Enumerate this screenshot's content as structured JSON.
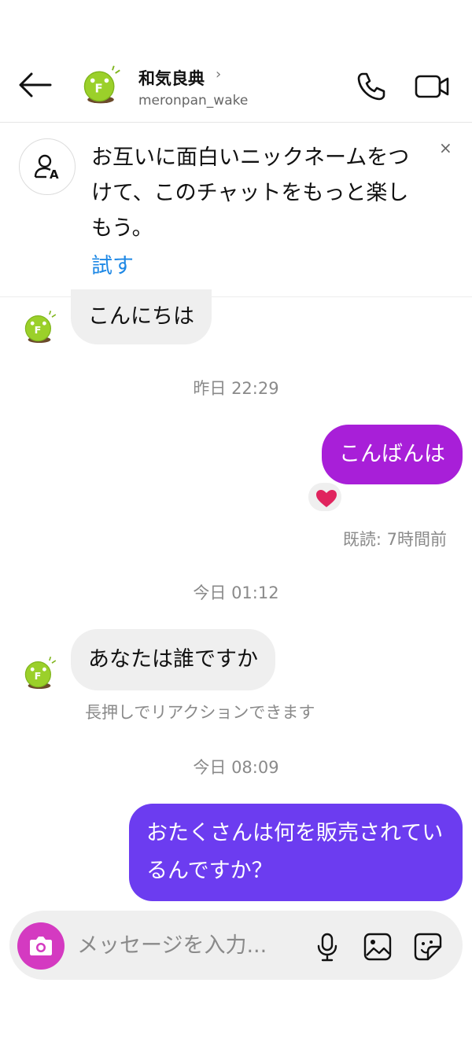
{
  "header": {
    "contact_name": "和気良典",
    "chevron": "›",
    "username": "meronpan_wake",
    "icons": [
      "back-arrow-icon",
      "phone-icon",
      "video-camera-icon"
    ]
  },
  "banner": {
    "text": "お互いに面白いニックネームをつけて、このチャットをもっと楽しもう。",
    "action_label": "試す",
    "close_symbol": "×",
    "icon": "nickname-person-icon"
  },
  "messages": [
    {
      "direction": "incoming",
      "text": "こんにちは"
    },
    {
      "timestamp": "昨日 22:29"
    },
    {
      "direction": "outgoing",
      "text": "こんばんは",
      "reaction": "❤️",
      "seen": "既読: 7時間前"
    },
    {
      "timestamp": "今日 01:12"
    },
    {
      "direction": "incoming",
      "text": "あなたは誰ですか",
      "hint": "長押しでリアクションできます"
    },
    {
      "timestamp": "今日 08:09"
    },
    {
      "direction": "outgoing",
      "text": "おたくさんは何を販売されているんですか？"
    }
  ],
  "composer": {
    "placeholder": "メッセージを入力...",
    "icons": [
      "camera-icon",
      "microphone-icon",
      "gallery-icon",
      "sticker-icon"
    ]
  },
  "colors": {
    "bubble_outgoing_1": "#a81fd8",
    "bubble_outgoing_2": "#6c3cf0",
    "bubble_incoming": "#efefef",
    "link_blue": "#1e88e5",
    "camera_button": "#d43ac1"
  }
}
